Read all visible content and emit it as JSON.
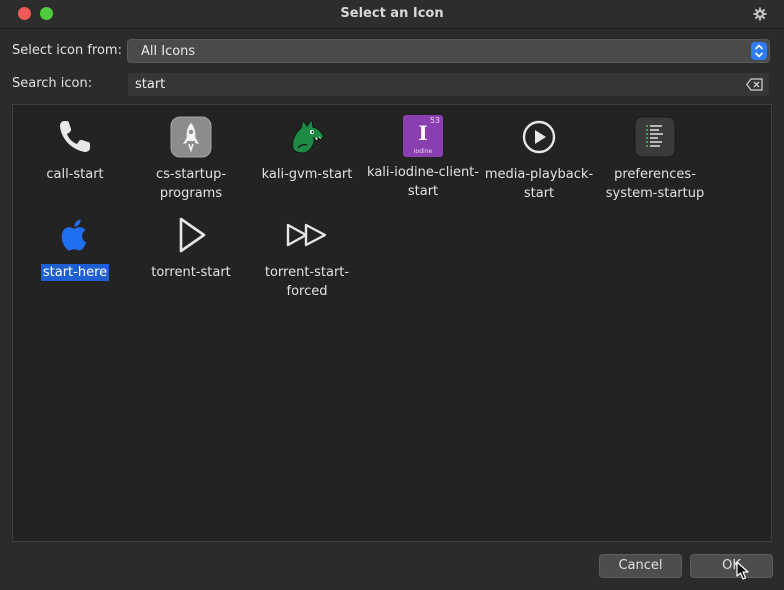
{
  "window": {
    "title": "Select an Icon"
  },
  "source": {
    "label": "Select icon from:",
    "value": "All Icons"
  },
  "search": {
    "label": "Search icon:",
    "value": "start"
  },
  "icons": [
    {
      "name": "call-start",
      "line1": "call-start",
      "line2": ""
    },
    {
      "name": "cs-startup-programs",
      "line1": "cs-startup-",
      "line2": "programs"
    },
    {
      "name": "kali-gvm-start",
      "line1": "kali-gvm-start",
      "line2": ""
    },
    {
      "name": "kali-iodine-client-start",
      "line1": "kali-iodine-client-",
      "line2": "start",
      "glyph": "I",
      "superscript": "53",
      "caption": "Iodine"
    },
    {
      "name": "media-playback-start",
      "line1": "media-playback-",
      "line2": "start"
    },
    {
      "name": "preferences-system-startup",
      "line1": "preferences-",
      "line2": "system-startup"
    },
    {
      "name": "start-here",
      "line1": "start-here",
      "line2": "",
      "selected": true
    },
    {
      "name": "torrent-start",
      "line1": "torrent-start",
      "line2": ""
    },
    {
      "name": "torrent-start-forced",
      "line1": "torrent-start-",
      "line2": "forced"
    }
  ],
  "buttons": {
    "cancel": "Cancel",
    "ok": "OK"
  },
  "colors": {
    "selection": "#1f5fd4",
    "accent_blue": "#2f7af5",
    "iodine_purple": "#8a3fb0"
  }
}
